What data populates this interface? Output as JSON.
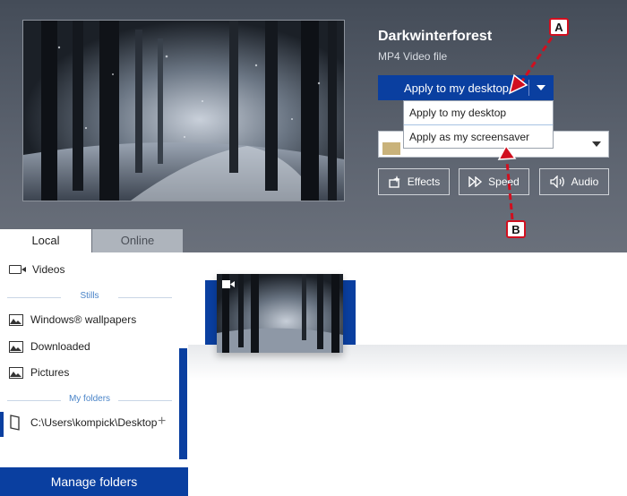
{
  "video": {
    "title": "Darkwinterforest",
    "type": "MP4 Video file"
  },
  "apply_button": {
    "label": "Apply to my desktop"
  },
  "apply_menu": {
    "items": [
      "Apply to my desktop",
      "Apply as my screensaver"
    ]
  },
  "controls": {
    "effects": "Effects",
    "speed": "Speed",
    "audio": "Audio"
  },
  "callouts": {
    "a": "A",
    "b": "B"
  },
  "tabs": {
    "local": "Local",
    "online": "Online"
  },
  "sidebar": {
    "videos": "Videos",
    "stills_header": "Stills",
    "windows_wallpapers": "Windows® wallpapers",
    "downloaded": "Downloaded",
    "pictures": "Pictures",
    "my_folders_header": "My folders",
    "folder_path": "C:\\Users\\kompick\\Desktop",
    "manage_folders": "Manage folders"
  },
  "icons": {
    "effects": "effects-icon",
    "speed": "fast-forward-icon",
    "audio": "speaker-icon",
    "video": "video-camera-icon",
    "image": "image-icon",
    "folder": "folder-icon",
    "add": "plus-icon"
  },
  "colors": {
    "accent": "#0a3fa0",
    "callout_border": "#d10f1f",
    "header_bg": "#555c67"
  }
}
